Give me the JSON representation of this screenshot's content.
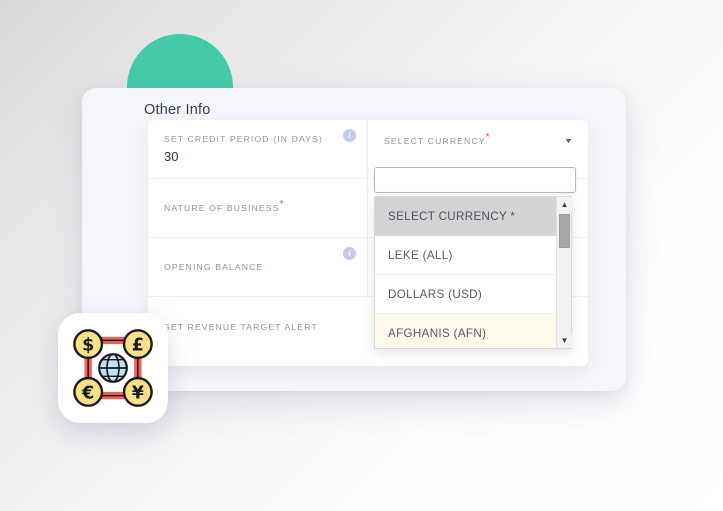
{
  "page": {
    "background_color": "#f2f2f2",
    "accent_color": "#45caa7"
  },
  "decor": {
    "circle_name": "teal-circle",
    "circle_color": "#45caa7"
  },
  "card": {
    "title": "Other Info",
    "background_color": "#f5f6fa"
  },
  "form": {
    "rows": [
      {
        "left": {
          "label": "SET CREDIT PERIOD (IN DAYS)",
          "value": "30",
          "required": false,
          "info_icon": "info-icon",
          "info_glyph": "i"
        },
        "right": {
          "label": "SELECT CURRENCY",
          "required": true,
          "required_mark": "*",
          "caret_glyph": "▼"
        }
      },
      {
        "left": {
          "label": "NATURE OF BUSINESS",
          "value": "",
          "required": true,
          "required_mark": "*"
        }
      },
      {
        "left": {
          "label": "OPENING BALANCE",
          "value": "",
          "required": false,
          "info_icon": "info-icon",
          "info_glyph": "i"
        }
      },
      {
        "full": {
          "label": "SET REVENUE TARGET ALERT",
          "value": "",
          "required": false
        }
      }
    ]
  },
  "dropdown": {
    "search_value": "",
    "search_placeholder": "",
    "options": [
      {
        "label": "SELECT CURRENCY *",
        "state": "selected"
      },
      {
        "label": "LEKE (ALL)",
        "state": "normal"
      },
      {
        "label": "DOLLARS (USD)",
        "state": "normal"
      },
      {
        "label": "AFGHANIS (AFN)",
        "state": "hovered"
      }
    ],
    "selected_background": "#d3d3d3",
    "hover_background": "#fdf9ec",
    "scrollbar": {
      "up_glyph": "▲",
      "down_glyph": "▼"
    }
  },
  "app_icon": {
    "name": "currency-exchange-icon",
    "symbols": [
      "$",
      "£",
      "€",
      "¥"
    ],
    "center": "globe",
    "coin_color": "#f7e08a",
    "connector_color": "#ee5f5f"
  }
}
